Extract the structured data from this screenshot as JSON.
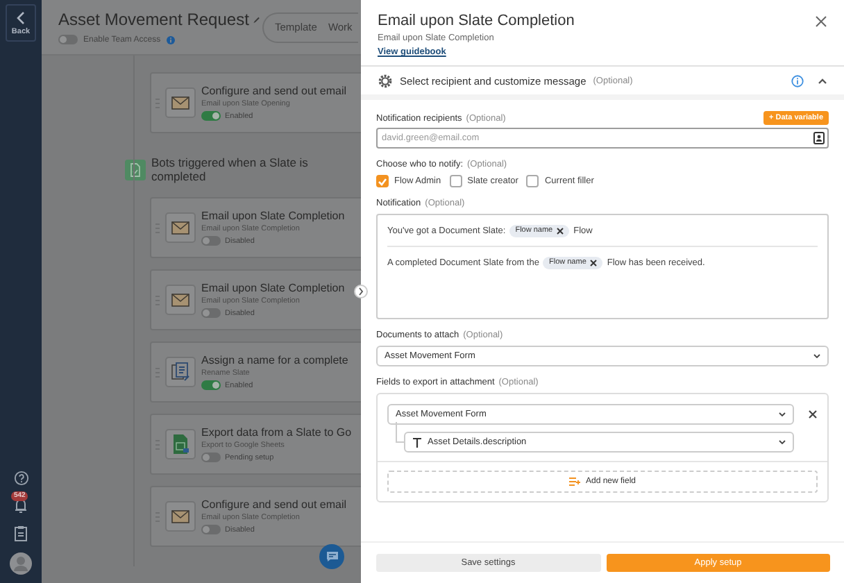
{
  "sidebar": {
    "back_label": "Back",
    "notification_count": "542"
  },
  "header": {
    "title": "Asset Movement Request",
    "team_access": {
      "label": "Enable Team Access",
      "on": false
    },
    "tabs": [
      {
        "label": "Template",
        "selected": false
      },
      {
        "label": "Work",
        "selected": false
      }
    ]
  },
  "flow": [
    {
      "kind": "email",
      "title": "Configure and send out email",
      "subtitle": "Email upon Slate Opening",
      "toggle": {
        "label": "Enabled",
        "on": true
      }
    },
    {
      "kind": "trigger",
      "title": "Bots triggered when a Slate is completed"
    },
    {
      "kind": "email",
      "title": "Email upon Slate Completion",
      "subtitle": "Email upon Slate Completion",
      "toggle": {
        "label": "Disabled",
        "on": false
      }
    },
    {
      "kind": "email",
      "title": "Email upon Slate Completion",
      "subtitle": "Email upon Slate Completion",
      "toggle": {
        "label": "Disabled",
        "on": false
      }
    },
    {
      "kind": "rename",
      "title": "Assign a name for a complete",
      "subtitle": "Rename Slate",
      "toggle": {
        "label": "Enabled",
        "on": true
      }
    },
    {
      "kind": "sheets",
      "title": "Export data from a Slate to Go",
      "subtitle": "Export to Google Sheets",
      "toggle": {
        "label": "Pending setup",
        "on": false
      }
    },
    {
      "kind": "email",
      "title": "Configure and send out email",
      "subtitle": "Email upon Slate Completion",
      "toggle": {
        "label": "Disabled",
        "on": false
      }
    }
  ],
  "panel": {
    "title": "Email upon Slate Completion",
    "subtitle": "Email upon Slate Completion",
    "guidebook_link": "View guidebook",
    "section": {
      "title": "Select recipient and customize message",
      "hint": "(Optional)",
      "expanded": true
    },
    "recipients": {
      "label": "Notification recipients",
      "hint": "(Optional)",
      "placeholder": "david.green@email.com",
      "data_variable_button": "+ Data variable"
    },
    "notify": {
      "label": "Choose who to notify:",
      "hint": "(Optional)",
      "options": [
        {
          "label": "Flow Admin",
          "checked": true
        },
        {
          "label": "Slate creator",
          "checked": false
        },
        {
          "label": "Current filler",
          "checked": false
        }
      ]
    },
    "notification": {
      "label": "Notification",
      "hint": "(Optional)",
      "lines": [
        [
          {
            "kind": "text",
            "text": "You've got a Document Slate:"
          },
          {
            "kind": "chip",
            "text": "Flow name"
          },
          {
            "kind": "text",
            "text": "Flow"
          }
        ],
        [
          {
            "kind": "text",
            "text": "A completed Document Slate from the"
          },
          {
            "kind": "chip",
            "text": "Flow name"
          },
          {
            "kind": "text",
            "text": "Flow has been received."
          }
        ]
      ]
    },
    "attach": {
      "label": "Documents to attach",
      "hint": "(Optional)",
      "value": "Asset Movement Form"
    },
    "export": {
      "label": "Fields to export in attachment",
      "hint": "(Optional)",
      "document": "Asset Movement Form",
      "field": "Asset Details.description",
      "add_button": "Add new field"
    },
    "footer": {
      "save": "Save settings",
      "apply": "Apply setup"
    }
  }
}
